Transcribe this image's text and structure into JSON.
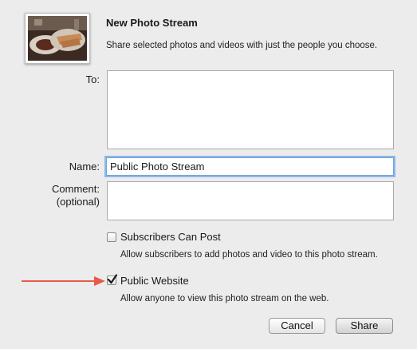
{
  "dialog": {
    "title": "New Photo Stream",
    "subtitle": "Share selected photos and videos with just the people you choose."
  },
  "form": {
    "to_label": "To:",
    "to_value": "",
    "name_label": "Name:",
    "name_value": "Public Photo Stream",
    "comment_label_line1": "Comment:",
    "comment_label_line2": "(optional)",
    "comment_value": ""
  },
  "options": {
    "subscribers_can_post": {
      "label": "Subscribers Can Post",
      "description": "Allow subscribers to add photos and video to this photo stream.",
      "checked": false
    },
    "public_website": {
      "label": "Public Website",
      "description": "Allow anyone to view this photo stream on the web.",
      "checked": true
    }
  },
  "buttons": {
    "cancel": "Cancel",
    "share": "Share"
  },
  "colors": {
    "background": "#ececec",
    "focus_ring": "#8db9ea",
    "arrow": "#e8594a"
  }
}
